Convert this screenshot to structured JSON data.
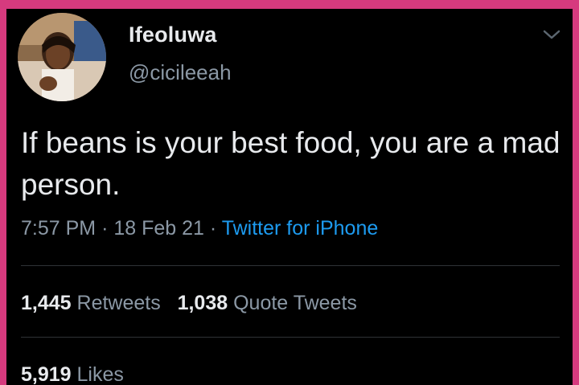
{
  "user": {
    "display_name": "Ifeoluwa",
    "handle": "@cicileeah"
  },
  "tweet": {
    "text": "If beans is your best food, you are a mad person.",
    "time": "7:57 PM",
    "date": "18 Feb 21",
    "separator": "·",
    "source": "Twitter for iPhone"
  },
  "stats": {
    "retweets_count": "1,445",
    "retweets_label": "Retweets",
    "quotes_count": "1,038",
    "quotes_label": "Quote Tweets",
    "likes_count": "5,919",
    "likes_label": "Likes"
  },
  "icons": {
    "menu": "chevron-down-icon",
    "avatar": "avatar"
  },
  "colors": {
    "border": "#d63a7e",
    "background": "#000000",
    "text": "#e8eaed",
    "secondary": "#8b98a5",
    "link": "#1d9bf0"
  }
}
